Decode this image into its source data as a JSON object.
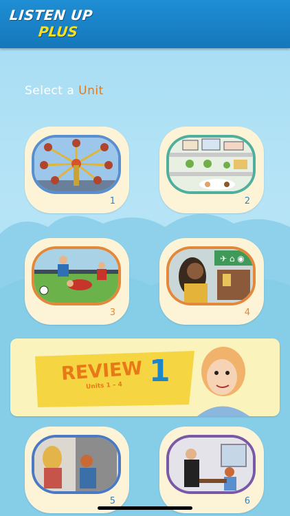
{
  "app": {
    "logo_line1": "LISTEN UP",
    "logo_line2": "PLUS"
  },
  "heading": {
    "prefix": "Select a ",
    "accent": "Unit"
  },
  "units": [
    {
      "number": "1",
      "number_color": "#2f84c8",
      "border_color": "#5a8fcf",
      "image": "amusement-ride-illustration"
    },
    {
      "number": "2",
      "number_color": "#2f84c8",
      "border_color": "#4fae9c",
      "image": "town-map-illustration"
    },
    {
      "number": "3",
      "number_color": "#e3883a",
      "border_color": "#e3883a",
      "image": "soccer-players-illustration"
    },
    {
      "number": "4",
      "number_color": "#e3883a",
      "border_color": "#e3883a",
      "image": "airport-traveler-illustration"
    },
    {
      "number": "5",
      "number_color": "#2f84c8",
      "border_color": "#4b79c4",
      "image": "friends-shopping-illustration"
    },
    {
      "number": "6",
      "number_color": "#2f84c8",
      "border_color": "#7a58a8",
      "image": "restaurant-waiter-illustration"
    }
  ],
  "review": {
    "label": "REVIEW",
    "units_text": "Units 1 – 4",
    "number": "1"
  }
}
